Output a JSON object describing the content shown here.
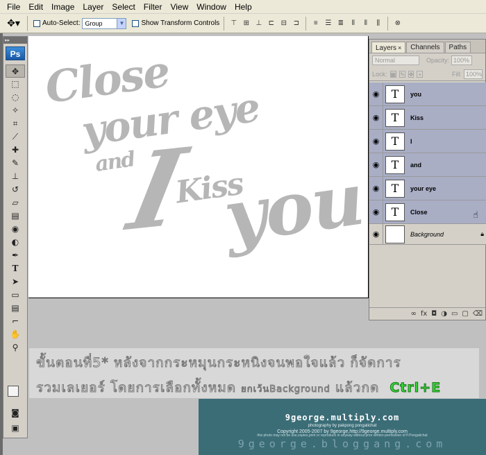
{
  "menu": [
    "File",
    "Edit",
    "Image",
    "Layer",
    "Select",
    "Filter",
    "View",
    "Window",
    "Help"
  ],
  "options": {
    "auto_select_label": "Auto-Select:",
    "auto_select_value": "Group",
    "transform_label": "Show Transform Controls"
  },
  "toolbox": {
    "logo": "Ps"
  },
  "canvas": {
    "line1": "Close",
    "line2": "your eye",
    "line3_and": "and",
    "line3_i": "I",
    "line3_kiss": "Kiss",
    "line3_you": "you"
  },
  "layers_panel": {
    "tabs": [
      "Layers",
      "Channels",
      "Paths"
    ],
    "blend_mode": "Normal",
    "opacity_label": "Opacity:",
    "opacity_value": "100%",
    "lock_label": "Lock:",
    "fill_label": "Fill:",
    "fill_value": "100%",
    "layers": [
      {
        "name": "you",
        "thumb": "T"
      },
      {
        "name": "Kiss",
        "thumb": "T"
      },
      {
        "name": "I",
        "thumb": "T"
      },
      {
        "name": "and",
        "thumb": "T"
      },
      {
        "name": "your eye",
        "thumb": "T"
      },
      {
        "name": "Close",
        "thumb": "T"
      },
      {
        "name": "Background",
        "thumb": ""
      }
    ]
  },
  "caption": {
    "line1": "ขั้นตอนที่5* หลังจากกระหมุนกระหนิงจนพอใจแล้ว ก็จัดการ",
    "line2a": "รวมเลเยอร์ โดยการเลือกทั้งหมด",
    "line2b": "ยกเว้นBackground",
    "line2c": "แล้วกด",
    "shortcut": "Ctrl+E"
  },
  "watermark": {
    "site": "9george.multiply.com",
    "photography": "photography by pakpong pongatichat",
    "copyright": "Copyright 2005-2007 by 9george,http://9george.multiply.com",
    "notice": "this photo may not be use,copies,print or reproduce in anyway without prior written permission of P.Pongatichat",
    "blog": "9george.bloggang.com"
  }
}
